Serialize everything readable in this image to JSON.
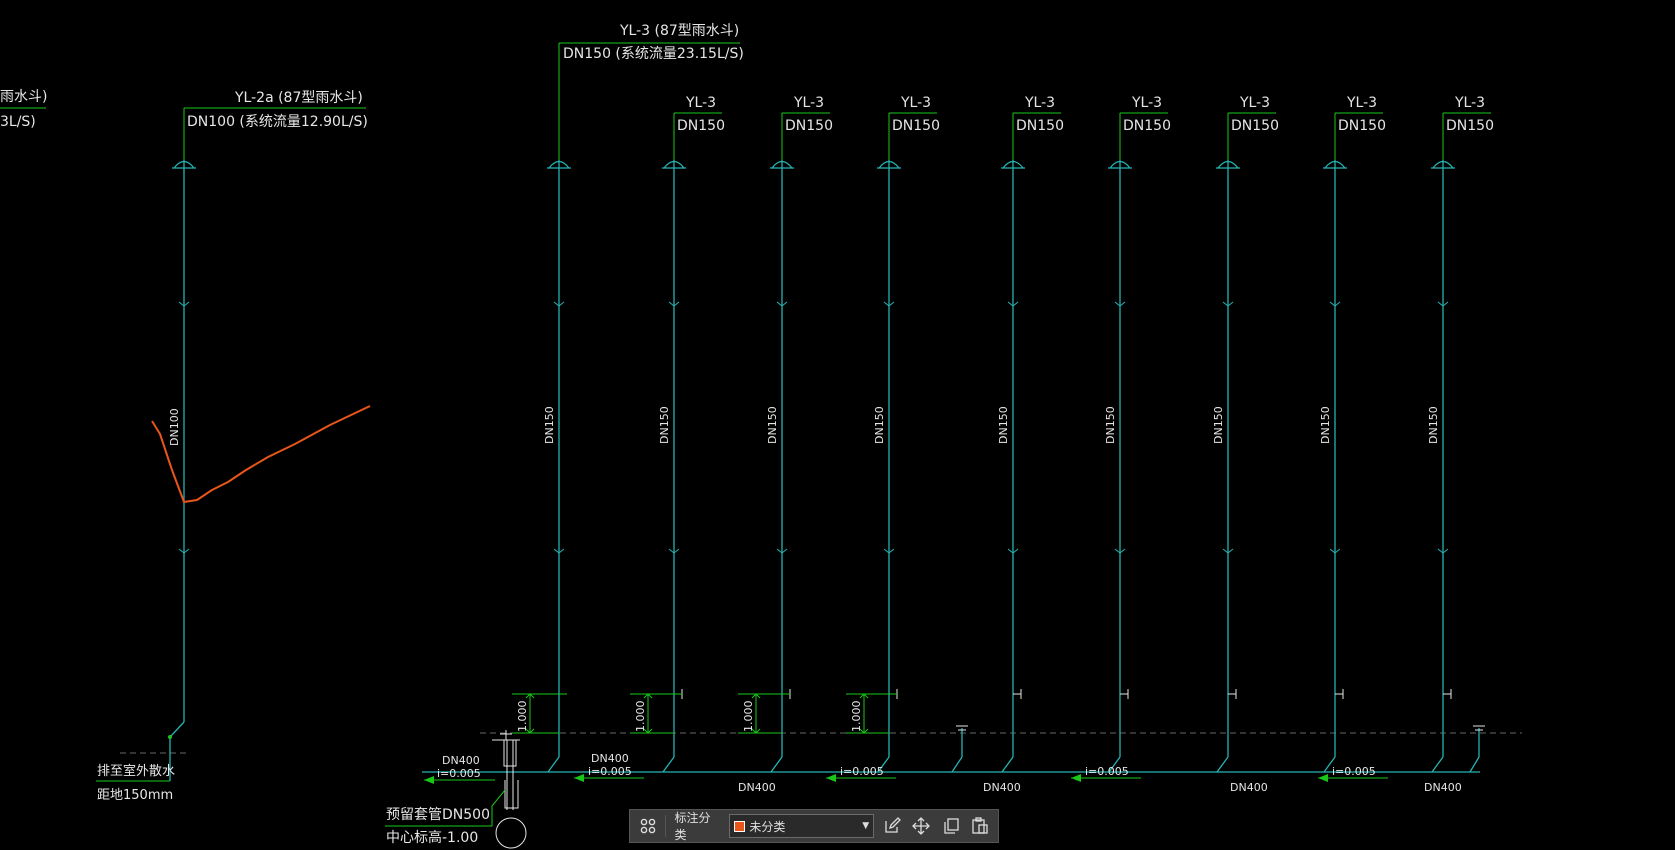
{
  "colors": {
    "background": "#000000",
    "pipe": "#26b3b3",
    "leader": "#19c719",
    "text": "#e6e6e6",
    "markup": "#e8561b",
    "ground": "#666666",
    "arrow": "#19c719"
  },
  "left_partial": {
    "line1": "雨水斗)",
    "line2": "3L/S)"
  },
  "yl2a": {
    "title": "YL-2a (87型雨水斗)",
    "spec": "DN100 (系统流量12.90L/S)",
    "pipe_label": "DN100",
    "outlet_line1": "排至室外散水",
    "outlet_line2": "距地150mm"
  },
  "main_riser": {
    "title": "YL-3 (87型雨水斗)",
    "spec": "DN150 (系统流量23.15L/S)",
    "pipe_label": "DN150"
  },
  "risers": [
    {
      "tag": "YL-3",
      "size": "DN150",
      "pipe_label": "DN150"
    },
    {
      "tag": "YL-3",
      "size": "DN150",
      "pipe_label": "DN150"
    },
    {
      "tag": "YL-3",
      "size": "DN150",
      "pipe_label": "DN150"
    },
    {
      "tag": "YL-3",
      "size": "DN150",
      "pipe_label": "DN150"
    },
    {
      "tag": "YL-3",
      "size": "DN150",
      "pipe_label": "DN150"
    },
    {
      "tag": "YL-3",
      "size": "DN150",
      "pipe_label": "DN150"
    },
    {
      "tag": "YL-3",
      "size": "DN150",
      "pipe_label": "DN150"
    },
    {
      "tag": "YL-3",
      "size": "DN150",
      "pipe_label": "DN150"
    }
  ],
  "elevation_marks": [
    "1.000",
    "1.000",
    "1.000",
    "1.000"
  ],
  "horizontal": {
    "dn_left": "DN400",
    "slope_left": "i=0.005",
    "dn_second": "DN400",
    "slope_second": "i=0.005",
    "dn_labels": [
      "DN400",
      "DN400",
      "DN400",
      "DN400"
    ],
    "slopes": [
      "i=0.005",
      "i=0.005",
      "i=0.005"
    ]
  },
  "sleeve": {
    "line1": "预留套管DN500",
    "line2": "中心标高-1.00"
  },
  "toolbar": {
    "grid_icon": "grid-icon",
    "label": "标注分类",
    "category_value": "未分类",
    "category_color": "#e8561b",
    "edit_icon": "edit-icon",
    "move_icon": "move-icon",
    "copy_icon": "copy-icon",
    "paste_icon": "paste-icon"
  }
}
